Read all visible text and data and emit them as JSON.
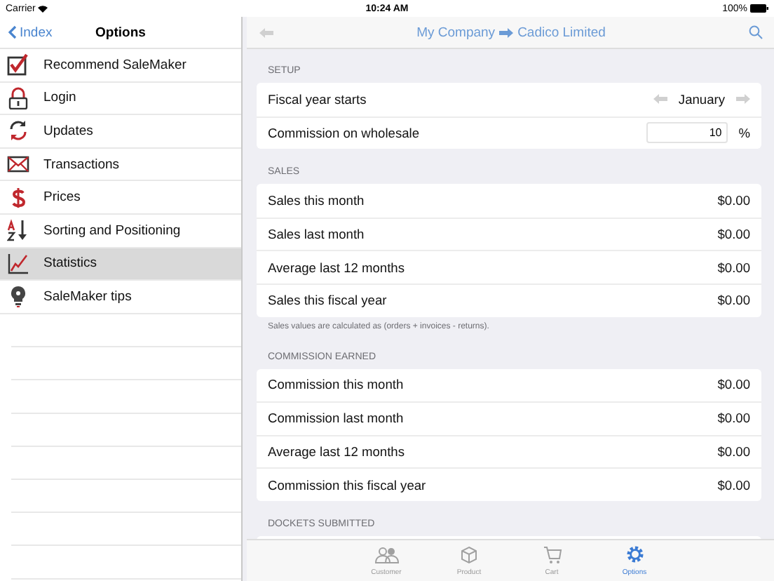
{
  "status_bar": {
    "carrier": "Carrier",
    "time": "10:24 AM",
    "battery": "100%"
  },
  "sidebar": {
    "back": "Index",
    "title": "Options",
    "items": [
      {
        "label": "Recommend SaleMaker",
        "selected": false
      },
      {
        "label": "Login",
        "selected": false
      },
      {
        "label": "Updates",
        "selected": false
      },
      {
        "label": "Transactions",
        "selected": false
      },
      {
        "label": "Prices",
        "selected": false
      },
      {
        "label": "Sorting and Positioning",
        "selected": false
      },
      {
        "label": "Statistics",
        "selected": true
      },
      {
        "label": "SaleMaker tips",
        "selected": false
      }
    ]
  },
  "nav": {
    "from": "My Company",
    "to": "Cadico Limited"
  },
  "sections": [
    {
      "header": "SETUP",
      "rows": [
        {
          "kind": "stepper",
          "label": "Fiscal year starts",
          "value": "January"
        },
        {
          "kind": "input",
          "label": "Commission on wholesale",
          "value": "10",
          "unit": "%"
        }
      ]
    },
    {
      "header": "SALES",
      "footer": "Sales values are calculated as (orders + invoices - returns).",
      "rows": [
        {
          "kind": "value",
          "label": "Sales this month",
          "value": "$0.00"
        },
        {
          "kind": "value",
          "label": "Sales last month",
          "value": "$0.00"
        },
        {
          "kind": "value",
          "label": "Average last 12 months",
          "value": "$0.00"
        },
        {
          "kind": "value",
          "label": "Sales this fiscal year",
          "value": "$0.00"
        }
      ]
    },
    {
      "header": "COMMISSION EARNED",
      "rows": [
        {
          "kind": "value",
          "label": "Commission this month",
          "value": "$0.00"
        },
        {
          "kind": "value",
          "label": "Commission last month",
          "value": "$0.00"
        },
        {
          "kind": "value",
          "label": "Average last 12 months",
          "value": "$0.00"
        },
        {
          "kind": "value",
          "label": "Commission this fiscal year",
          "value": "$0.00"
        }
      ]
    },
    {
      "header": "DOCKETS SUBMITTED"
    }
  ],
  "tabs": [
    {
      "label": "Customer",
      "selected": false
    },
    {
      "label": "Product",
      "selected": false
    },
    {
      "label": "Cart",
      "selected": false
    },
    {
      "label": "Options",
      "selected": true
    }
  ]
}
